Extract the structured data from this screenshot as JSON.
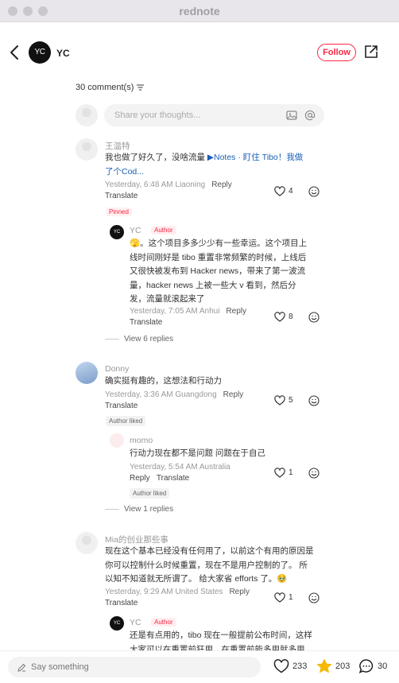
{
  "window": {
    "title": "rednote"
  },
  "header": {
    "author_name": "YC",
    "avatar_text": "YC",
    "follow_label": "Follow"
  },
  "comments_header": {
    "count_label": "30 comment(s)"
  },
  "input": {
    "placeholder": "Share your thoughts..."
  },
  "comments": [
    {
      "user": "王温特",
      "text_line1_prefix": "我也做了好久了，没啥流量 ",
      "text_line1_link": "Notes · 盯住 Tibo！我做",
      "text_line2_link": "了个Cod...",
      "meta": "Yesterday, 6:48 AM Liaoning",
      "reply_label": "Reply",
      "translate_label": "Translate",
      "likes": "4",
      "badge": "Pinned",
      "reply": {
        "user": "YC",
        "avatar_text": "YC",
        "badge": "Author",
        "lines": [
          "🫣。这个项目多多少少有一些幸运。这个项目上",
          "线时间刚好是 tibo 重置非常频繁的时候，上线后",
          "又很快被发布到 Hacker news，带来了第一波流",
          "量，hacker news 上被一些大 v 看到，然后分",
          "发，流量就滚起来了"
        ],
        "meta": "Yesterday, 7:05 AM Anhui",
        "reply_label": "Reply",
        "translate_label": "Translate",
        "likes": "8"
      },
      "view_replies": "View 6 replies"
    },
    {
      "user": "Donny",
      "text": "确实挺有趣的，这想法和行动力",
      "meta": "Yesterday, 3:36 AM Guangdong",
      "reply_label": "Reply",
      "translate_label": "Translate",
      "likes": "5",
      "badge": "Author liked",
      "reply": {
        "user": "momo",
        "text": "行动力现在都不是问题 问题在于自己",
        "meta": "Yesterday, 5:54 AM Australia",
        "reply_label": "Reply",
        "translate_label": "Translate",
        "likes": "1",
        "badge": "Author liked"
      },
      "view_replies": "View 1 replies"
    },
    {
      "user": "Mia的创业那些事",
      "lines": [
        "现在这个基本已经没有任何用了，以前这个有用的原因是",
        "你可以控制什么时候重置，现在不是用户控制的了。 所",
        "以知不知道就无所谓了。 给大家省 efforts 了。🥹"
      ],
      "meta": "Yesterday, 9:29 AM United States",
      "reply_label": "Reply",
      "translate_label": "Translate",
      "likes": "1",
      "reply": {
        "user": "YC",
        "avatar_text": "YC",
        "badge": "Author",
        "lines": [
          "还是有点用的，tibo 现在一般提前公布时间，这样",
          "大家可以在重置前狂用，在重置前能多用就多用"
        ]
      }
    }
  ],
  "bottom": {
    "say_placeholder": "Say something",
    "likes": "233",
    "stars": "203",
    "comments": "30"
  },
  "colors": {
    "accent": "#ff2442",
    "star": "#f5b800",
    "link": "#1a5fb4"
  }
}
